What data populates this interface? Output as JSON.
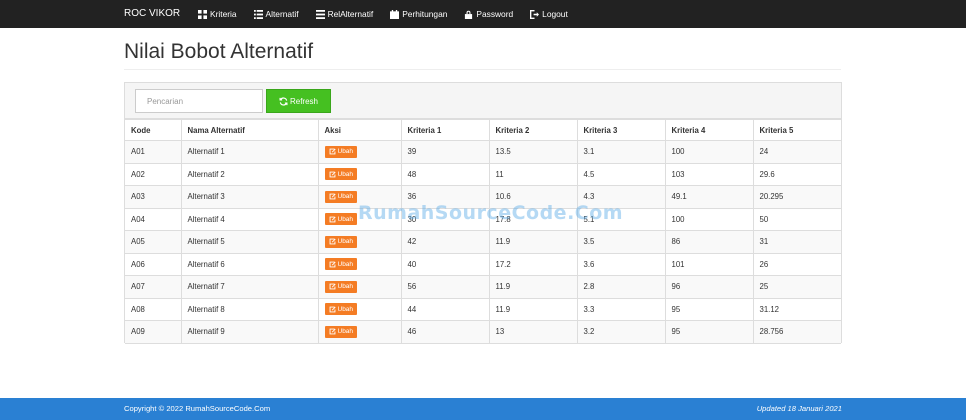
{
  "navbar": {
    "brand": "ROC VIKOR",
    "items": [
      {
        "label": "Kriteria",
        "icon": "grid-icon"
      },
      {
        "label": "Alternatif",
        "icon": "list-icon"
      },
      {
        "label": "RelAlternatif",
        "icon": "list-alt-icon"
      },
      {
        "label": "Perhitungan",
        "icon": "calendar-icon"
      },
      {
        "label": "Password",
        "icon": "lock-icon"
      },
      {
        "label": "Logout",
        "icon": "logout-icon"
      }
    ]
  },
  "page": {
    "title": "Nilai Bobot Alternatif"
  },
  "toolbar": {
    "search_placeholder": "Pencarian",
    "refresh_label": "Refresh"
  },
  "table": {
    "headers": [
      "Kode",
      "Nama Alternatif",
      "Aksi",
      "Kriteria 1",
      "Kriteria 2",
      "Kriteria 3",
      "Kriteria 4",
      "Kriteria 5"
    ],
    "action_label": "Ubah",
    "rows": [
      {
        "kode": "A01",
        "nama": "Alternatif 1",
        "k1": "39",
        "k2": "13.5",
        "k3": "3.1",
        "k4": "100",
        "k5": "24"
      },
      {
        "kode": "A02",
        "nama": "Alternatif 2",
        "k1": "48",
        "k2": "11",
        "k3": "4.5",
        "k4": "103",
        "k5": "29.6"
      },
      {
        "kode": "A03",
        "nama": "Alternatif 3",
        "k1": "36",
        "k2": "10.6",
        "k3": "4.3",
        "k4": "49.1",
        "k5": "20.295"
      },
      {
        "kode": "A04",
        "nama": "Alternatif 4",
        "k1": "30",
        "k2": "17.8",
        "k3": "5.1",
        "k4": "100",
        "k5": "50"
      },
      {
        "kode": "A05",
        "nama": "Alternatif 5",
        "k1": "42",
        "k2": "11.9",
        "k3": "3.5",
        "k4": "86",
        "k5": "31"
      },
      {
        "kode": "A06",
        "nama": "Alternatif 6",
        "k1": "40",
        "k2": "17.2",
        "k3": "3.6",
        "k4": "101",
        "k5": "26"
      },
      {
        "kode": "A07",
        "nama": "Alternatif 7",
        "k1": "56",
        "k2": "11.9",
        "k3": "2.8",
        "k4": "96",
        "k5": "25"
      },
      {
        "kode": "A08",
        "nama": "Alternatif 8",
        "k1": "44",
        "k2": "11.9",
        "k3": "3.3",
        "k4": "95",
        "k5": "31.12"
      },
      {
        "kode": "A09",
        "nama": "Alternatif 9",
        "k1": "46",
        "k2": "13",
        "k3": "3.2",
        "k4": "95",
        "k5": "28.756"
      }
    ]
  },
  "watermark": "RumahSourceCode.Com",
  "footer": {
    "copyright": "Copyright © 2022 RumahSourceCode.Com",
    "updated": "Updated 18 Januari 2021"
  },
  "colors": {
    "navbar": "#222222",
    "refresh_button": "#45c021",
    "ubah_button": "#f47c24",
    "footer": "#2a80d3"
  }
}
